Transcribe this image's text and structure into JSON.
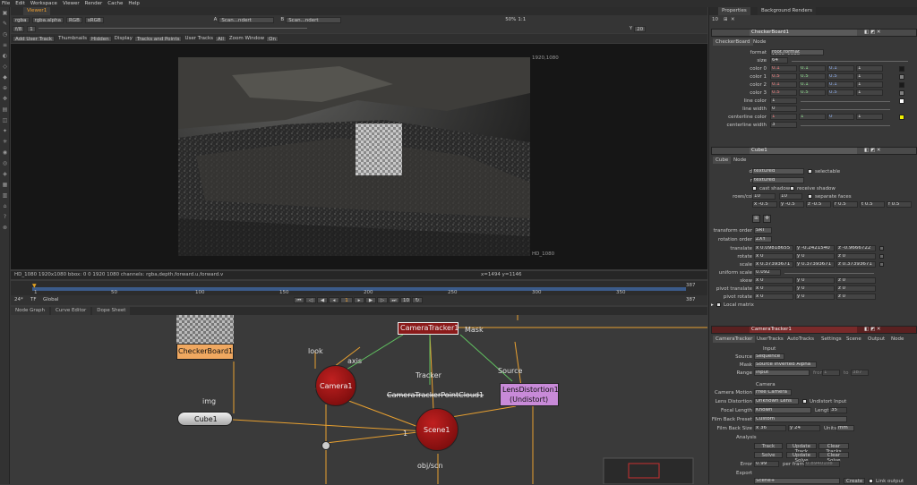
{
  "menu": [
    "File",
    "Edit",
    "Workspace",
    "Viewer",
    "Render",
    "Cache",
    "Help"
  ],
  "viewer": {
    "tab": "Viewer1",
    "bar1": {
      "layer": "rgba",
      "channel": "rgba.alpha",
      "rgb": "RGB",
      "lut": "sRGB",
      "a_input": "A",
      "a_value": "Scan...ndert",
      "b_value": "B",
      "b_input": "Scan...ndert",
      "zoom_info": "50%",
      "ratio": "1:1",
      "gain": "f/8",
      "gamma": "1",
      "yval": "Y",
      "f_value": "1",
      "frame": "20"
    },
    "bar2": {
      "add_user_track": "Add User Track",
      "thumbnails_label": "Thumbnails",
      "thumbnails_val": "Hidden",
      "display_label": "Display",
      "display_val": "Tracks and Points",
      "user_tracks_label": "User Tracks",
      "user_tracks_val": "All",
      "zoom_window_label": "Zoom Window",
      "zoom_window_val": "On"
    },
    "frame_tl": "1920,1080",
    "frame_br": "HD_1080",
    "info_left": "HD_1080 1920x1080  bbox: 0 0 1920 1080 channels: rgba,depth,forward.u,forward.v",
    "info_right": "x=1494 y=1146"
  },
  "timeline": {
    "ticks": [
      "1",
      "50",
      "100",
      "150",
      "200",
      "250",
      "300",
      "350"
    ],
    "end": "387",
    "fps": "24*",
    "tf": "TF",
    "global": "Global",
    "frame_current": "1",
    "step": "10",
    "end_right": "387"
  },
  "nodegraph": {
    "tabs": [
      "Node Graph",
      "Curve Editor",
      "Dope Sheet"
    ],
    "nodes": {
      "checkerboard": "CheckerBoard1",
      "cameratracker": "CameraTracker1",
      "camera": "Camera1",
      "pointcloud": "CameraTrackerPointCloud1",
      "lensdistortion_l1": "LensDistortion1",
      "lensdistortion_l2": "(Undistort)",
      "scene": "Scene1",
      "cube": "Cube1"
    },
    "edges": {
      "look": "look",
      "axis": "axis",
      "tracker": "Tracker",
      "mask": "Mask",
      "source": "Source",
      "img": "img",
      "objscn": "obj/scn",
      "one": "1"
    }
  },
  "properties": {
    "tabs": [
      "Properties",
      "Background Renders"
    ],
    "count": "10",
    "checker": {
      "name": "CheckerBoard1",
      "subtabs": [
        "CheckerBoard",
        "Node"
      ],
      "format_label": "format",
      "format_val": "root.format 1920x1080",
      "size_label": "size",
      "size_val": "64",
      "color0": {
        "label": "color 0",
        "v": [
          "0.1",
          "0.1",
          "0.1",
          "1"
        ]
      },
      "color1": {
        "label": "color 1",
        "v": [
          "0.5",
          "0.5",
          "0.5",
          "1"
        ]
      },
      "color2": {
        "label": "color 2",
        "v": [
          "0.1",
          "0.1",
          "0.1",
          "1"
        ]
      },
      "color3": {
        "label": "color 3",
        "v": [
          "0.5",
          "0.5",
          "0.5",
          "1"
        ]
      },
      "linecolor": {
        "label": "line color",
        "v": "1"
      },
      "linewidth": {
        "label": "line width",
        "v": "0"
      },
      "centerline_color": {
        "label": "centerline color",
        "v": [
          "1",
          "1",
          "0",
          "1"
        ]
      },
      "centerline_width": {
        "label": "centerline width",
        "v": "3"
      }
    },
    "cube": {
      "name": "Cube1",
      "subtabs": [
        "Cube",
        "Node"
      ],
      "display_label": "display",
      "display_val": "textured",
      "selectable": "selectable",
      "render_label": "render",
      "render_val": "textured",
      "cast_shadow": "cast shadow",
      "receive_shadow": "receive shadow",
      "rows_label": "rows/columns",
      "rows": "10",
      "cols": "10",
      "separate_faces": "separate faces",
      "cube_label": "cube",
      "cube_vals": [
        "x -0.5",
        "y -0.5",
        "z -0.5",
        "r 0.5",
        "t 0.5",
        "f 0.5"
      ],
      "transform_order_label": "transform order",
      "transform_order_val": "SRT",
      "rotation_order_label": "rotation order",
      "rotation_order_val": "ZXY",
      "translate_label": "translate",
      "translate_vals": [
        "x 0.09818655",
        "y -0.2421540",
        "z -0.9666722"
      ],
      "rotate_label": "rotate",
      "rotate_vals": [
        "x 0",
        "y 0",
        "z 0"
      ],
      "scale_label": "scale",
      "scale_vals": [
        "x 0.37393671",
        "y 0.37393671",
        "z 0.37393671"
      ],
      "uniform_label": "uniform scale",
      "uniform_val": "0.092",
      "skew_label": "skew",
      "skew_vals": [
        "x 0",
        "y 0",
        "z 0"
      ],
      "pivot_translate_label": "pivot translate",
      "pivot_translate_vals": [
        "x 0",
        "y 0",
        "z 0"
      ],
      "pivot_rotate_label": "pivot rotate",
      "pivot_rotate_vals": [
        "x 0",
        "y 0",
        "z 0"
      ],
      "local_matrix": "Local matrix"
    },
    "ct": {
      "name": "CameraTracker1",
      "subtabs": [
        "CameraTracker",
        "UserTracks",
        "AutoTracks",
        "Settings",
        "Scene",
        "Output",
        "Node"
      ],
      "input": "Input",
      "source_label": "Source",
      "source_val": "Sequence",
      "mask_label": "Mask",
      "mask_val": "Source Inverted Alpha",
      "range_label": "Range",
      "range_val": "Input",
      "range_from_label": "from",
      "range_from": "1",
      "range_to_label": "to",
      "range_to": "387",
      "camera": "Camera",
      "camera_motion_label": "Camera Motion",
      "camera_motion_val": "Free Camera",
      "lens_label": "Lens Distortion",
      "lens_val": "Unknown Lens",
      "undistort": "Undistort Input",
      "focal_label": "Focal Length",
      "focal_val": "Known",
      "length_label": "Length",
      "length_val": "35",
      "filmback_label": "Film Back Preset",
      "filmback_val": "Custom",
      "filmsize_label": "Film Back Size",
      "fx": "x 36",
      "fy": "y 24",
      "units_label": "Units",
      "units_val": "mm",
      "analysis": "Analysis",
      "track": "Track",
      "update_track": "Update Track",
      "clear_tracks": "Clear Tracks",
      "solve": "Solve",
      "update_solve": "Update Solve",
      "clear_solve": "Clear Solve",
      "error_label": "Error",
      "error_val": "0.99",
      "perframe_label": "per frame",
      "perframe_val": "0.8940108",
      "export_label": "Export",
      "export_val": "Scene+",
      "create": "Create",
      "link_output": "Link output"
    }
  }
}
